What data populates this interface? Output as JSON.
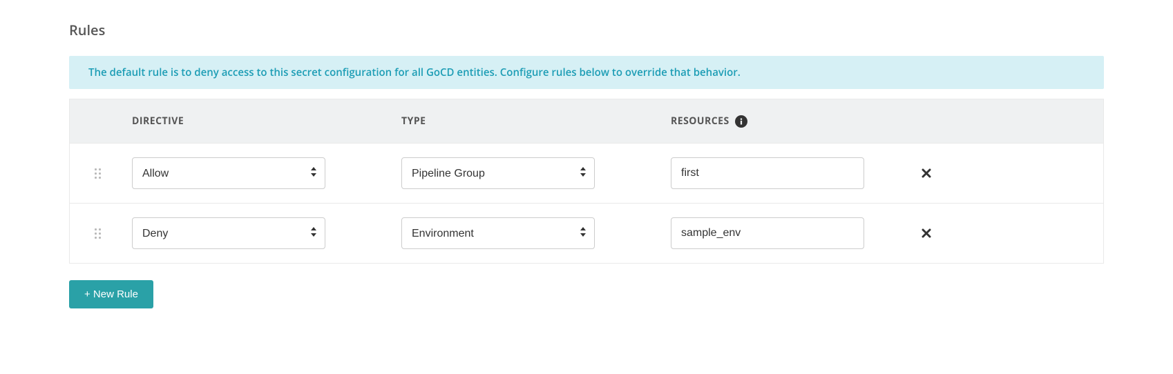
{
  "section_title": "Rules",
  "info_banner": "The default rule is to deny access to this secret configuration for all GoCD entities. Configure rules below to override that behavior.",
  "headers": {
    "directive": "DIRECTIVE",
    "type": "TYPE",
    "resources": "RESOURCES"
  },
  "directive_options": [
    "Allow",
    "Deny"
  ],
  "type_options": [
    "Pipeline Group",
    "Environment"
  ],
  "rows": [
    {
      "directive": "Allow",
      "type": "Pipeline Group",
      "resource": "first"
    },
    {
      "directive": "Deny",
      "type": "Environment",
      "resource": "sample_env"
    }
  ],
  "add_rule_label": "+ New Rule"
}
